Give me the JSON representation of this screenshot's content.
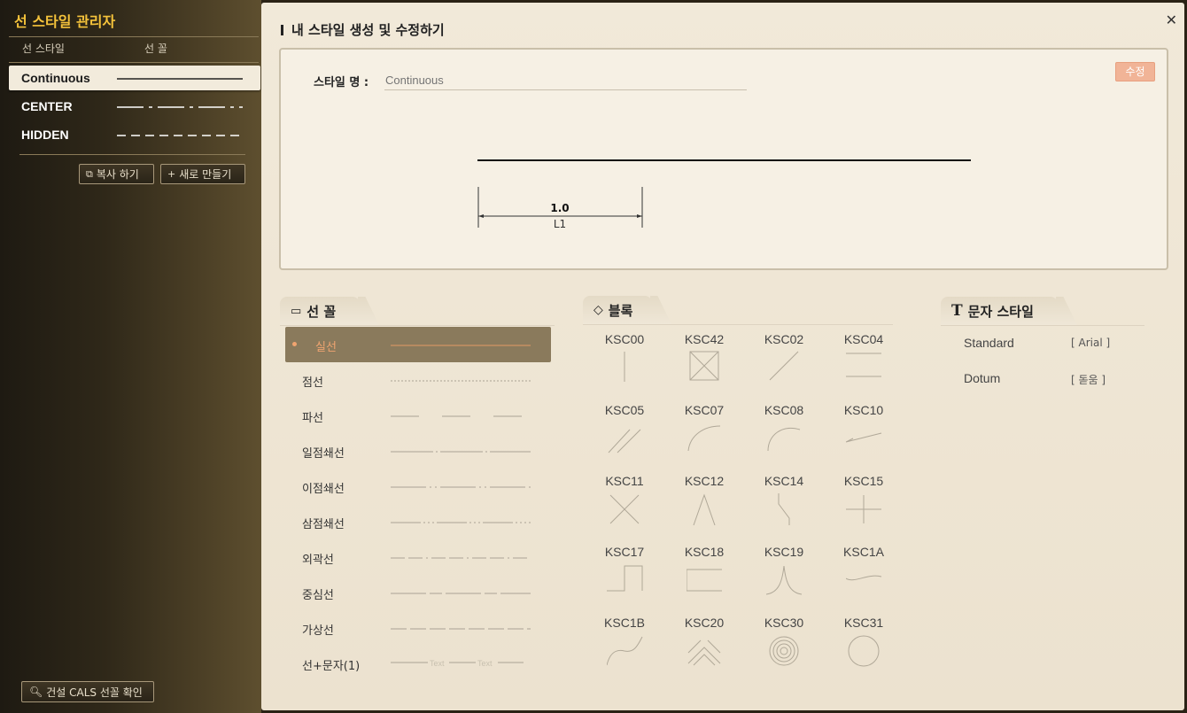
{
  "sidebar": {
    "title": "선 스타일 관리자",
    "col_style": "선 스타일",
    "col_shape": "선 꼴",
    "styles": [
      {
        "name": "Continuous",
        "pattern": "continuous",
        "selected": true
      },
      {
        "name": "CENTER",
        "pattern": "center",
        "selected": false
      },
      {
        "name": "HIDDEN",
        "pattern": "hidden",
        "selected": false
      }
    ],
    "copy_label": "복사 하기",
    "new_label": "새로 만들기",
    "cals_label": "건설 CALS 선꼴 확인"
  },
  "main": {
    "title": "내 스타일 생성 및 수정하기",
    "style_name_label": "스타일 명 :",
    "style_name_placeholder": "Continuous",
    "edit_label": "수정",
    "dim_value": "1.0",
    "dim_label": "L1"
  },
  "linetypes": {
    "tab_label": "선 꼴",
    "items": [
      {
        "label": "실선",
        "pattern": "solid",
        "selected": true
      },
      {
        "label": "점선",
        "pattern": "dotted",
        "selected": false
      },
      {
        "label": "파선",
        "pattern": "dashed",
        "selected": false
      },
      {
        "label": "일점쇄선",
        "pattern": "dashdot",
        "selected": false
      },
      {
        "label": "이점쇄선",
        "pattern": "dashdotdot",
        "selected": false
      },
      {
        "label": "삼점쇄선",
        "pattern": "dashdot3",
        "selected": false
      },
      {
        "label": "외곽선",
        "pattern": "border",
        "selected": false
      },
      {
        "label": "중심선",
        "pattern": "center",
        "selected": false
      },
      {
        "label": "가상선",
        "pattern": "phantom",
        "selected": false
      },
      {
        "label": "선+문자(1)",
        "pattern": "text",
        "selected": false
      }
    ],
    "text_sample": "Text"
  },
  "blocks": {
    "tab_label": "블록",
    "items": [
      "KSC00",
      "KSC42",
      "KSC02",
      "KSC04",
      "KSC05",
      "KSC07",
      "KSC08",
      "KSC10",
      "KSC11",
      "KSC12",
      "KSC14",
      "KSC15",
      "KSC17",
      "KSC18",
      "KSC19",
      "KSC1A",
      "KSC1B",
      "KSC20",
      "KSC30",
      "KSC31"
    ]
  },
  "textstyles": {
    "tab_label": "문자 스타일",
    "items": [
      {
        "name": "Standard",
        "font": "[ Arial ]"
      },
      {
        "name": "Dotum",
        "font": "[ 돋움 ]"
      }
    ]
  },
  "colors": {
    "accent": "#f5c33b",
    "edit_button": "#f1b497",
    "selected_row": "#8a7a5c",
    "selected_text": "#f0a470"
  }
}
